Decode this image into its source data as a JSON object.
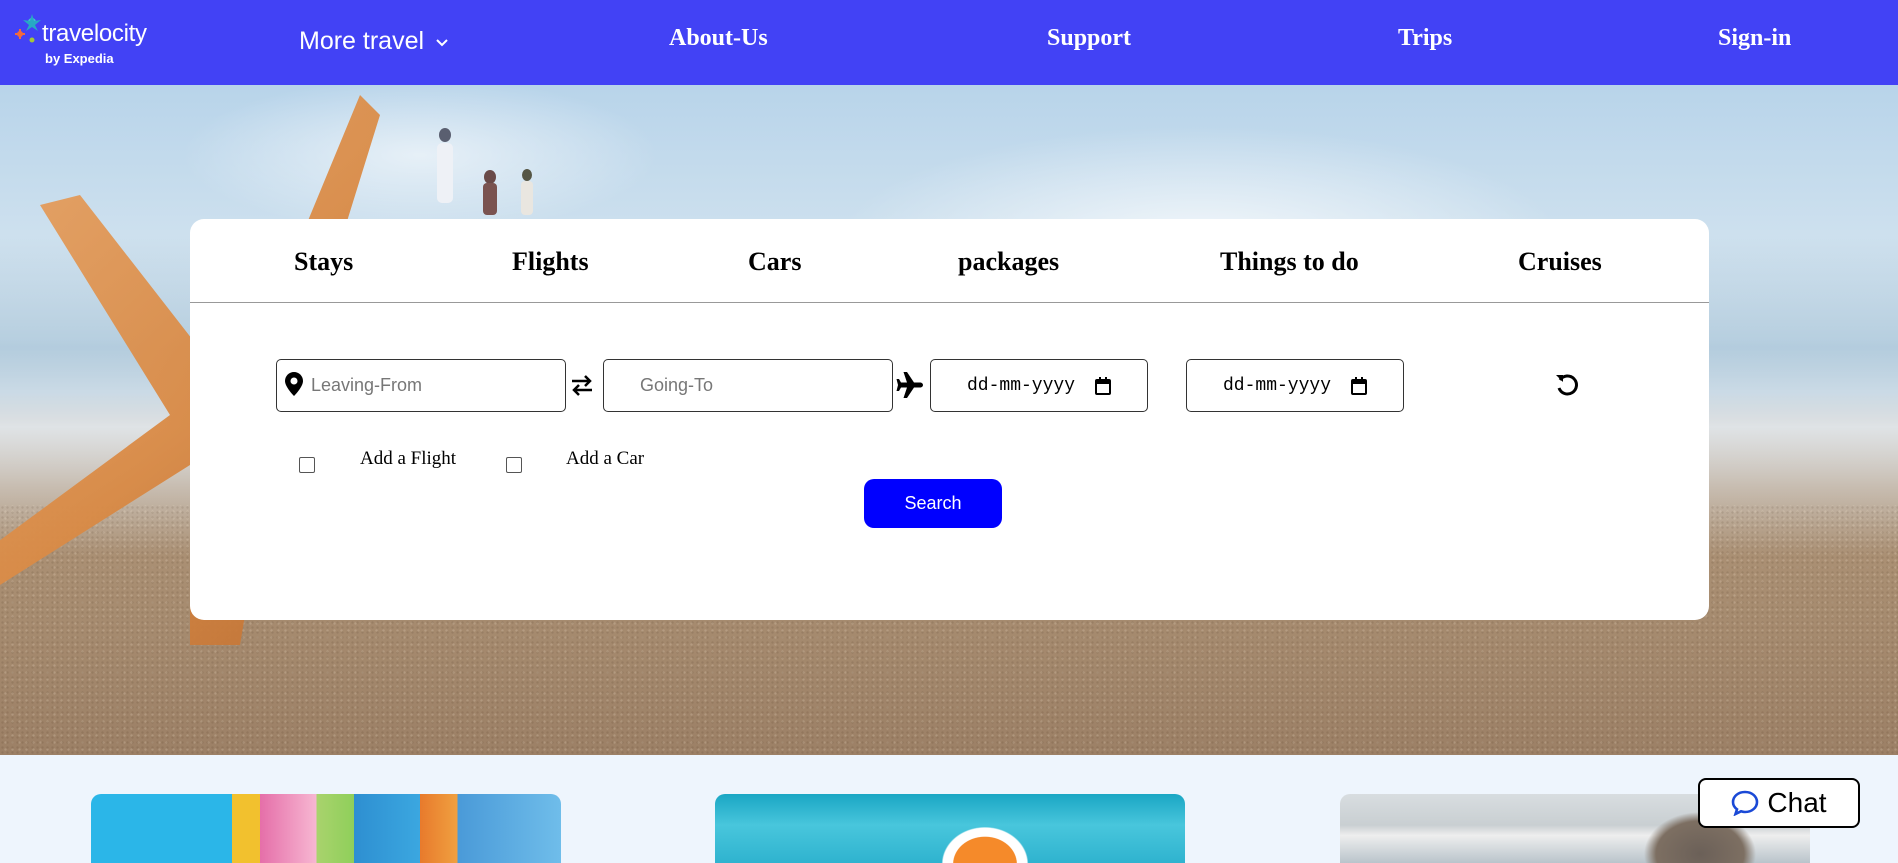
{
  "header": {
    "logo_text": "travelocity",
    "logo_sub": "by Expedia",
    "more_travel": "More travel",
    "nav": [
      "About-Us",
      "Support",
      "Trips",
      "Sign-in"
    ]
  },
  "search_card": {
    "tabs": [
      "Stays",
      "Flights",
      "Cars",
      "packages",
      "Things to do",
      "Cruises"
    ],
    "leaving_placeholder": "Leaving-From",
    "going_placeholder": "Going-To",
    "date1": "dd-mm-yyyy",
    "date2": "dd-mm-yyyy",
    "add_flight": "Add a Flight",
    "add_car": "Add a Car",
    "search_label": "Search"
  },
  "chat": {
    "label": "Chat"
  },
  "colors": {
    "nav_bg": "#4242f5",
    "search_button": "#0000ff",
    "bottom_bg": "#eef5fd"
  },
  "icons": [
    "map-pin-icon",
    "swap-arrows-icon",
    "airplane-icon",
    "calendar-icon",
    "refresh-icon",
    "chat-bubble-icon",
    "chevron-down-icon"
  ]
}
